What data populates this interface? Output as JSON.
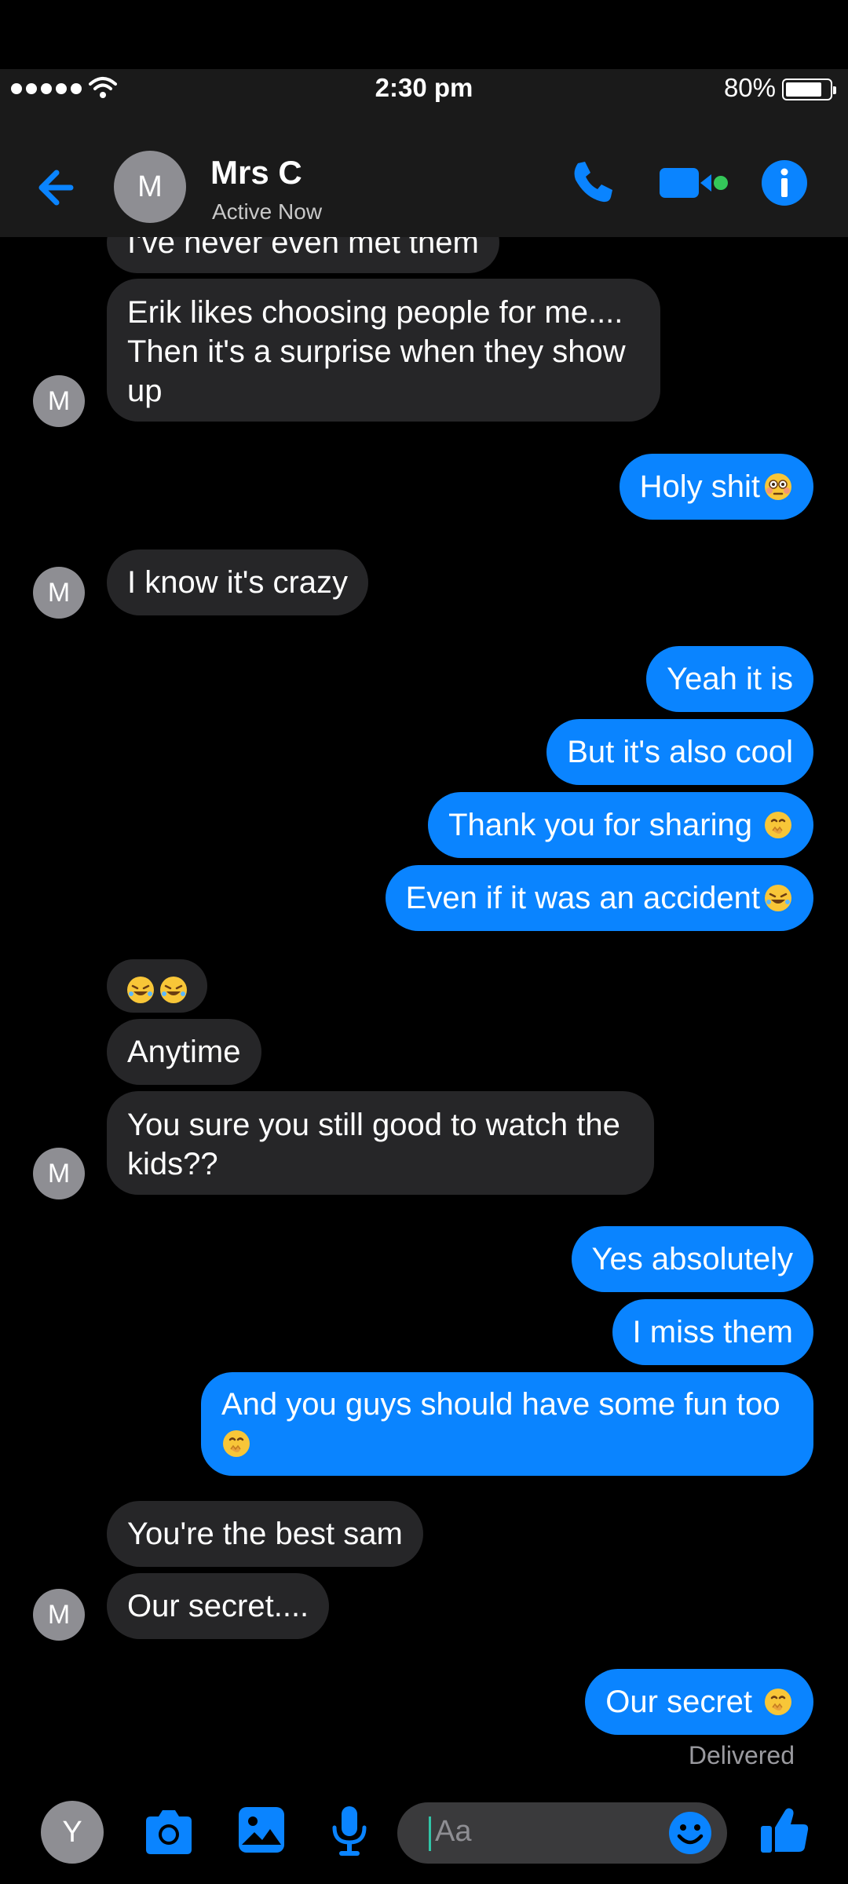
{
  "status_bar": {
    "time": "2:30 pm",
    "battery": "80%"
  },
  "header": {
    "avatar_letter": "M",
    "name": "Mrs C",
    "subtitle": "Active Now"
  },
  "messages": [
    {
      "from": "them",
      "text": "I've never even met them"
    },
    {
      "from": "them",
      "text": "Erik likes choosing people for me.... Then it's a surprise when they show up"
    },
    {
      "from": "me",
      "text": "Holy shit"
    },
    {
      "from": "them",
      "text": "I know it's crazy"
    },
    {
      "from": "me",
      "text": "Yeah it is"
    },
    {
      "from": "me",
      "text": "But it's also cool"
    },
    {
      "from": "me",
      "text": "Thank you for sharing"
    },
    {
      "from": "me",
      "text": "Even if it was an accident"
    },
    {
      "from": "them",
      "text": ""
    },
    {
      "from": "them",
      "text": "Anytime"
    },
    {
      "from": "them",
      "text": "You sure you still good to watch the kids??"
    },
    {
      "from": "me",
      "text": "Yes absolutely"
    },
    {
      "from": "me",
      "text": "I miss them"
    },
    {
      "from": "me",
      "text": "And you guys should have some fun too"
    },
    {
      "from": "them",
      "text": "You're the best sam"
    },
    {
      "from": "them",
      "text": "Our secret...."
    },
    {
      "from": "me",
      "text": "Our secret"
    }
  ],
  "contact_avatar_letter": "M",
  "delivery_status": "Delivered",
  "composer": {
    "avatar_letter": "Y",
    "placeholder": "Aa"
  },
  "icons": [
    "back-arrow-icon",
    "phone-icon",
    "video-icon",
    "info-icon",
    "camera-icon",
    "photo-icon",
    "microphone-icon",
    "smiley-icon",
    "thumbs-up-icon",
    "flushed-face-emoji",
    "face-with-hand-over-mouth-emoji",
    "rolling-on-floor-laughing-emoji"
  ],
  "colors": {
    "accent": "#0a84ff",
    "incoming_bubble": "#262628",
    "outgoing_bubble": "#0a84ff",
    "header": "#1a1a1a",
    "active_dot": "#34c759"
  }
}
